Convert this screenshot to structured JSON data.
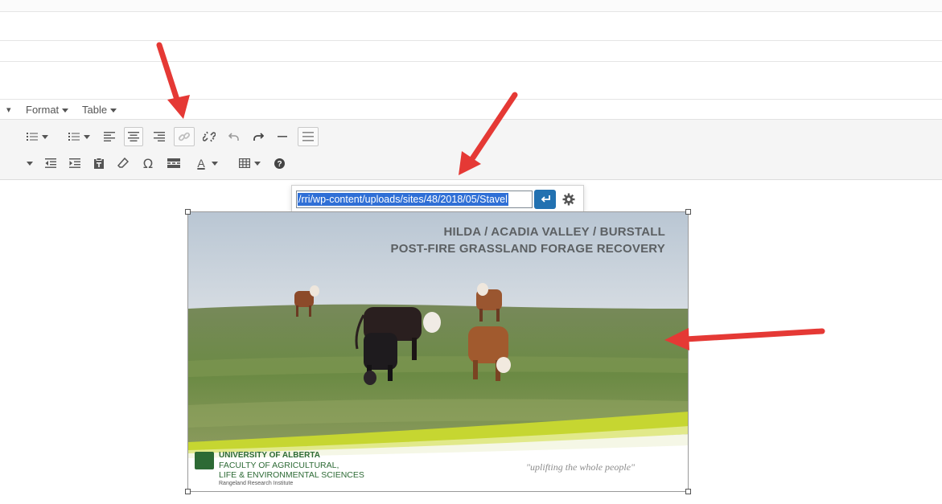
{
  "menubar": {
    "items": [
      {
        "label": "Format"
      },
      {
        "label": "Table"
      }
    ]
  },
  "toolbar": {
    "row1": [
      "bullet-list-icon",
      "numbered-list-icon",
      "align-left-icon",
      "align-center-icon",
      "align-right-icon",
      "insert-link-icon",
      "unlink-icon",
      "undo-icon",
      "redo-icon",
      "horizontal-line-icon",
      "toolbar-toggle-icon"
    ],
    "row2": [
      "outdent-icon",
      "indent-icon",
      "paste-as-text-icon",
      "clear-formatting-icon",
      "special-character-icon",
      "read-more-icon",
      "text-color-icon",
      "table-icon",
      "help-icon"
    ],
    "special_char_glyph": "Ω",
    "text_color_glyph": "A",
    "text_color": "#2c2c2c"
  },
  "link_popup": {
    "url_value": "/rri/wp-content/uploads/sites/48/2018/05/Stavel",
    "apply_icon": "enter-arrow-icon",
    "settings_icon": "gear-icon"
  },
  "image": {
    "title_line1": "HILDA / ACADIA VALLEY / BURSTALL",
    "title_line2": "POST-FIRE GRASSLAND FORAGE RECOVERY",
    "university": "UNIVERSITY OF ALBERTA",
    "faculty_line1": "FACULTY OF AGRICULTURAL,",
    "faculty_line2": "LIFE & ENVIRONMENTAL SCIENCES",
    "institute": "Rangeland Research Institute",
    "tagline": "\"uplifting the whole people\""
  },
  "colors": {
    "accent": "#2271b1",
    "arrow": "#e53935",
    "selection": "#2f6fd6"
  }
}
